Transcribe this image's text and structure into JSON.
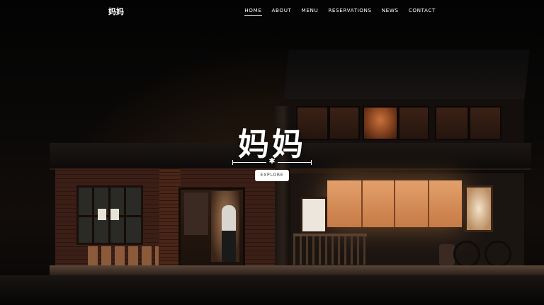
{
  "site": {
    "logo": "妈妈"
  },
  "nav": {
    "items": [
      {
        "label": "HOME",
        "active": true
      },
      {
        "label": "ABOUT",
        "active": false
      },
      {
        "label": "MENU",
        "active": false
      },
      {
        "label": "RESERVATIONS",
        "active": false
      },
      {
        "label": "NEWS",
        "active": false
      },
      {
        "label": "CONTACT",
        "active": false
      }
    ]
  },
  "hero": {
    "title": "妈妈",
    "divider_glyph": "✱",
    "explore_label": "EXPLORE",
    "background": "night-restaurant-storefront-photo"
  },
  "colors": {
    "background": "#050505",
    "text": "#ffffff",
    "button_bg": "#ffffff",
    "button_text": "#333333",
    "noren_glow": "#e3a06c"
  },
  "icons": {
    "divider": "asterisk-ornament-icon"
  }
}
